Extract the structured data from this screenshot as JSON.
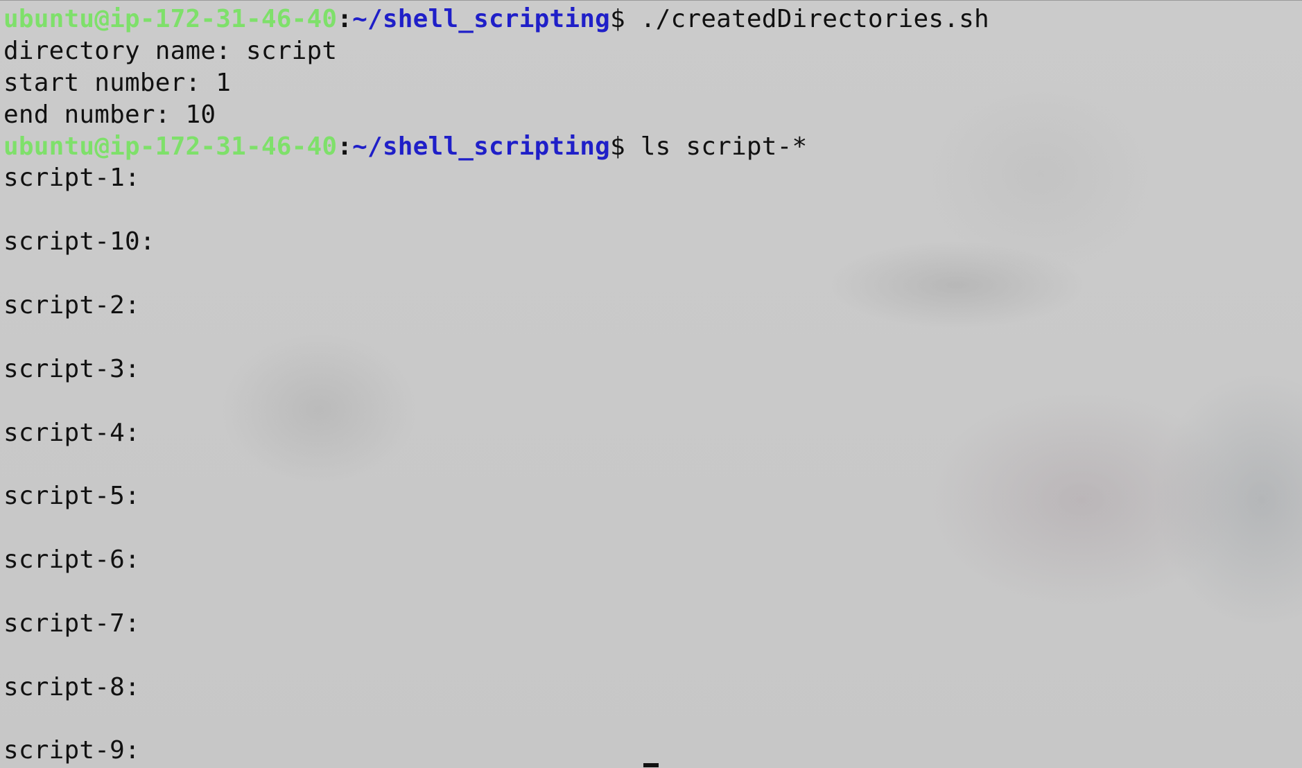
{
  "terminal": {
    "background_color": "#c9c9c9",
    "prompt_user_color": "#7ee06a",
    "prompt_path_color": "#1f1fc8",
    "text_color": "#111111",
    "prompt": {
      "user_host": "ubuntu@ip-172-31-46-40",
      "separator": ":",
      "path": "~/shell_scripting",
      "symbol": "$"
    },
    "commands": [
      {
        "text": " ./createdDirectories.sh"
      },
      {
        "text": " ls script-*"
      }
    ],
    "output_block_1": [
      "directory name: script",
      "start number: 1",
      "end number: 10"
    ],
    "output_block_2": [
      "script-1:",
      "",
      "script-10:",
      "",
      "script-2:",
      "",
      "script-3:",
      "",
      "script-4:",
      "",
      "script-5:",
      "",
      "script-6:",
      "",
      "script-7:",
      "",
      "script-8:",
      "",
      "script-9:"
    ]
  }
}
